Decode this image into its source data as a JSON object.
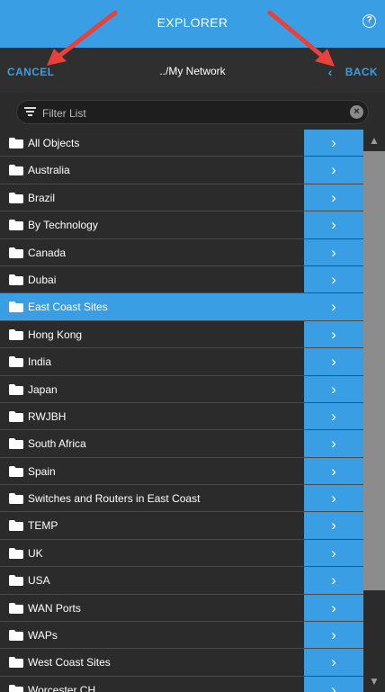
{
  "header": {
    "title": "EXPLORER",
    "help_icon": "help-circle-icon"
  },
  "nav": {
    "cancel_label": "CANCEL",
    "path": "../My Network",
    "back_label": "BACK"
  },
  "filter": {
    "placeholder": "Filter List"
  },
  "colors": {
    "accent": "#3a9ee4",
    "background": "#2b2b2b",
    "arrow": "#e8413a"
  },
  "list": {
    "selected_index": 6,
    "items": [
      {
        "label": "All Objects"
      },
      {
        "label": "Australia"
      },
      {
        "label": "Brazil"
      },
      {
        "label": "By Technology"
      },
      {
        "label": "Canada"
      },
      {
        "label": "Dubai"
      },
      {
        "label": "East Coast Sites"
      },
      {
        "label": "Hong Kong"
      },
      {
        "label": "India"
      },
      {
        "label": "Japan"
      },
      {
        "label": "RWJBH"
      },
      {
        "label": "South Africa"
      },
      {
        "label": "Spain"
      },
      {
        "label": "Switches and Routers in East Coast"
      },
      {
        "label": "TEMP"
      },
      {
        "label": "UK"
      },
      {
        "label": "USA"
      },
      {
        "label": "WAN Ports"
      },
      {
        "label": "WAPs"
      },
      {
        "label": "West Coast Sites"
      },
      {
        "label": "Worcester CH"
      }
    ]
  }
}
